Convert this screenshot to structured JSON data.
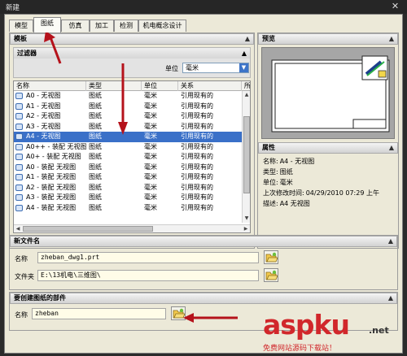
{
  "window": {
    "title": "新建",
    "close_glyph": "✕"
  },
  "tabs": [
    {
      "label": "模型",
      "active": false
    },
    {
      "label": "图纸",
      "active": true
    },
    {
      "label": "仿真",
      "active": false
    },
    {
      "label": "加工",
      "active": false
    },
    {
      "label": "检测",
      "active": false
    },
    {
      "label": "机电概念设计",
      "active": false
    }
  ],
  "template_panel": {
    "title": "模板",
    "collapse_glyph": "▲",
    "filter": {
      "title": "过滤器",
      "unit_label": "单位",
      "unit_value": "毫米"
    },
    "columns": [
      "名称",
      "类型",
      "单位",
      "关系",
      "所"
    ],
    "rows": [
      {
        "name": "A0 - 无视图",
        "type": "图纸",
        "unit": "毫米",
        "relation": "引用现有的",
        "selected": false
      },
      {
        "name": "A1 - 无视图",
        "type": "图纸",
        "unit": "毫米",
        "relation": "引用现有的",
        "selected": false
      },
      {
        "name": "A2 - 无视图",
        "type": "图纸",
        "unit": "毫米",
        "relation": "引用现有的",
        "selected": false
      },
      {
        "name": "A3 - 无视图",
        "type": "图纸",
        "unit": "毫米",
        "relation": "引用现有的",
        "selected": false
      },
      {
        "name": "A4 - 无视图",
        "type": "图纸",
        "unit": "毫米",
        "relation": "引用现有的",
        "selected": true
      },
      {
        "name": "A0++ - 装配 无视图",
        "type": "图纸",
        "unit": "毫米",
        "relation": "引用现有的",
        "selected": false
      },
      {
        "name": "A0+ - 装配 无视图",
        "type": "图纸",
        "unit": "毫米",
        "relation": "引用现有的",
        "selected": false
      },
      {
        "name": "A0 - 装配 无视图",
        "type": "图纸",
        "unit": "毫米",
        "relation": "引用现有的",
        "selected": false
      },
      {
        "name": "A1 - 装配 无视图",
        "type": "图纸",
        "unit": "毫米",
        "relation": "引用现有的",
        "selected": false
      },
      {
        "name": "A2 - 装配 无视图",
        "type": "图纸",
        "unit": "毫米",
        "relation": "引用现有的",
        "selected": false
      },
      {
        "name": "A3 - 装配 无视图",
        "type": "图纸",
        "unit": "毫米",
        "relation": "引用现有的",
        "selected": false
      },
      {
        "name": "A4 - 装配 无视图",
        "type": "图纸",
        "unit": "毫米",
        "relation": "引用现有的",
        "selected": false
      }
    ]
  },
  "preview_panel": {
    "title": "预览"
  },
  "properties_panel": {
    "title": "属性",
    "items": [
      {
        "key": "名称:",
        "value": "A4 - 无视图"
      },
      {
        "key": "类型:",
        "value": "图纸"
      },
      {
        "key": "单位:",
        "value": "毫米"
      },
      {
        "key": "上次修改时间:",
        "value": "04/29/2010 07:29 上午"
      },
      {
        "key": "描述:",
        "value": "A4 无视图"
      }
    ]
  },
  "new_file": {
    "title": "新文件名",
    "name_label": "名称",
    "name_value": "zheban_dwg1.prt",
    "folder_label": "文件夹",
    "folder_value": "E:\\13机电\\三维图\\"
  },
  "parts": {
    "title": "要创建图纸的部件",
    "name_label": "名称",
    "name_value": "zheban"
  },
  "watermark": {
    "brand": "aspku",
    "suffix": ".net",
    "subtitle": "免费网站源码下载站！"
  },
  "colors": {
    "selection": "#3a70c8",
    "arrow": "#b5121b",
    "watermark": "#d1272b"
  }
}
